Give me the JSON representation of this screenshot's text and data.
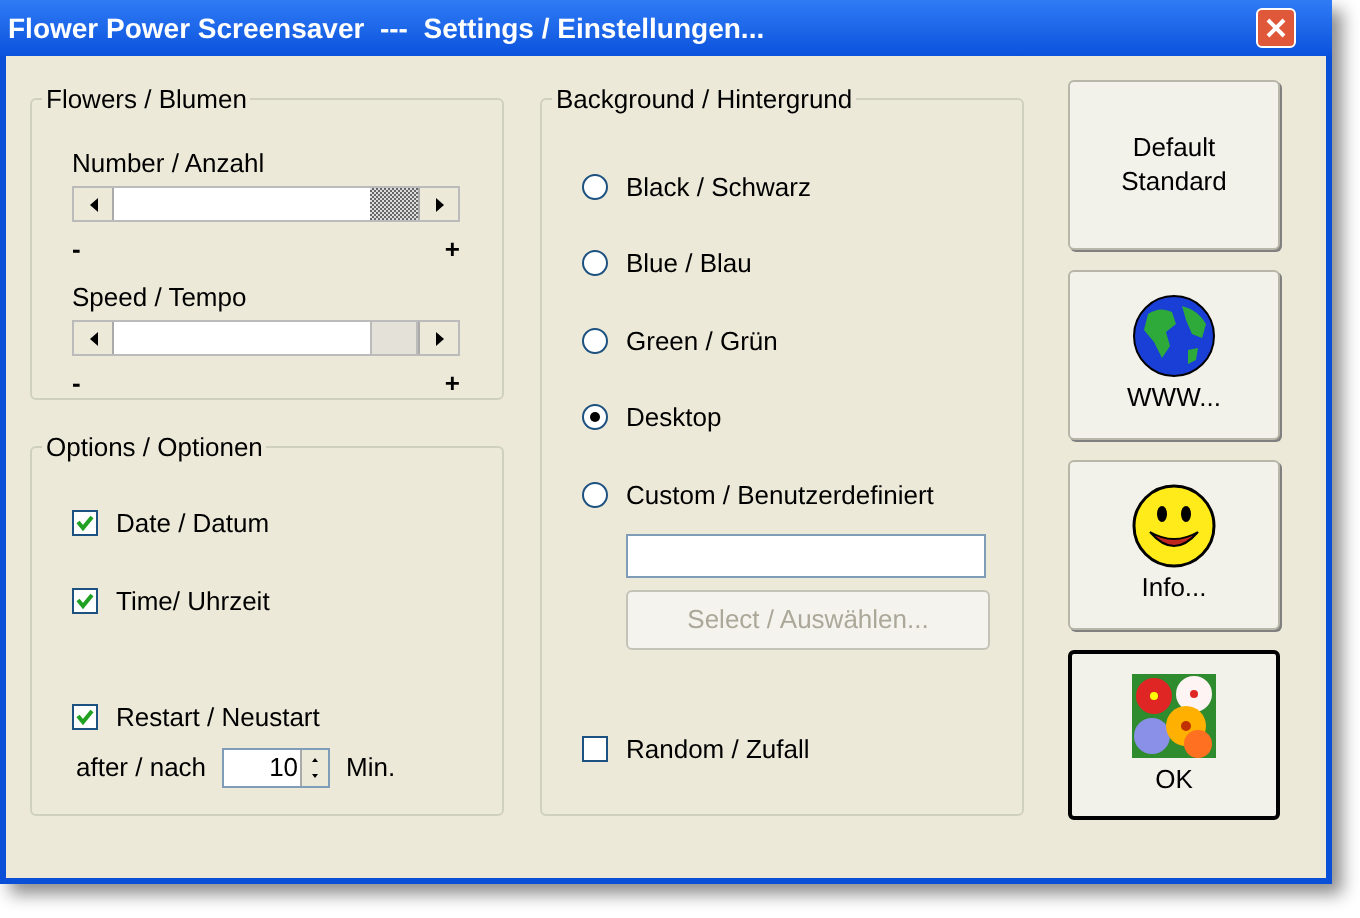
{
  "window": {
    "title": "Flower Power Screensaver  ---  Settings / Einstellungen..."
  },
  "flowers": {
    "title": "Flowers / Blumen",
    "sliders": [
      {
        "label": "Number / Anzahl",
        "focused": true,
        "min_label": "-",
        "max_label": "+"
      },
      {
        "label": "Speed / Tempo",
        "focused": false,
        "min_label": "-",
        "max_label": "+"
      }
    ]
  },
  "options": {
    "title": "Options / Optionen",
    "checkboxes": [
      {
        "label": "Date / Datum",
        "checked": true
      },
      {
        "label": "Time/ Uhrzeit",
        "checked": true
      },
      {
        "label": "Restart / Neustart",
        "checked": true
      }
    ],
    "restart_after": {
      "label": "after / nach",
      "value": "10",
      "unit": "Min."
    }
  },
  "background": {
    "title": "Background / Hintergrund",
    "radios": [
      {
        "label": "Black / Schwarz",
        "selected": false
      },
      {
        "label": "Blue / Blau",
        "selected": false
      },
      {
        "label": "Green / Grün",
        "selected": false
      },
      {
        "label": "Desktop",
        "selected": true
      },
      {
        "label": "Custom / Benutzerdefiniert",
        "selected": false
      }
    ],
    "select_button": {
      "label": "Select / Auswählen...",
      "disabled": true
    },
    "random": {
      "label": "Random / Zufall",
      "checked": false
    }
  },
  "buttons": [
    {
      "kind": "text",
      "label": "Default\nStandard",
      "default": false
    },
    {
      "kind": "globe",
      "label": "WWW...",
      "default": false
    },
    {
      "kind": "smiley",
      "label": "Info...",
      "default": false
    },
    {
      "kind": "flowers",
      "label": "OK",
      "default": true
    }
  ]
}
